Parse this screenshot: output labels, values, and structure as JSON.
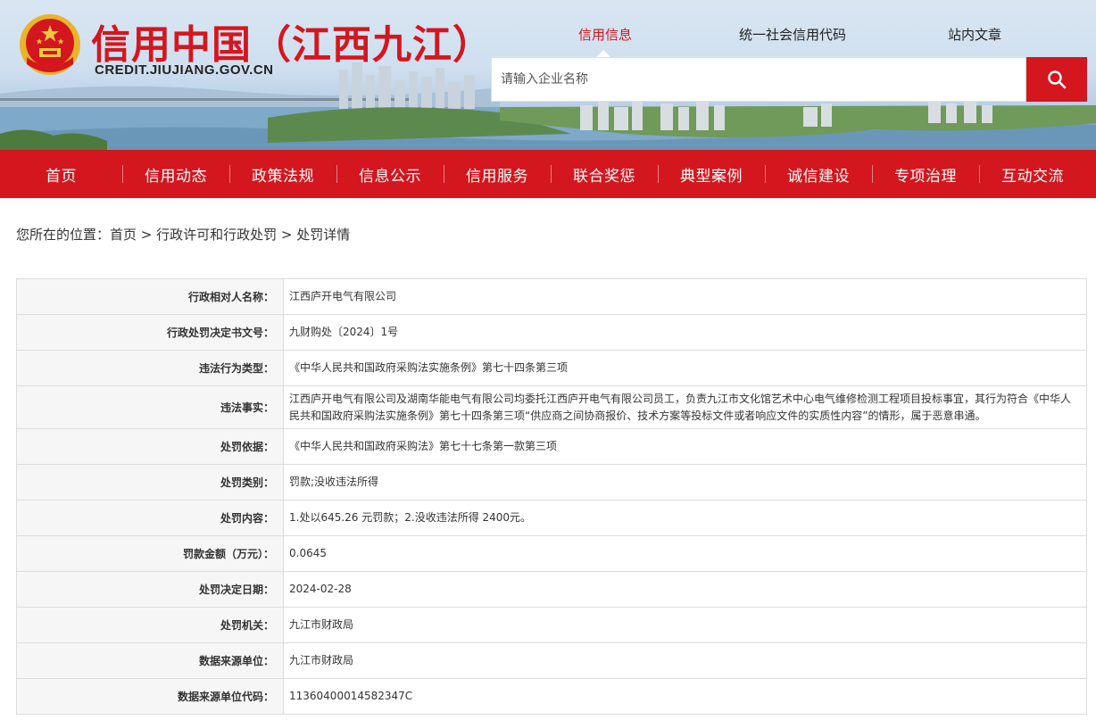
{
  "header": {
    "site_title": "信用中国（江西九江）",
    "site_url": "CREDIT.JIUJIANG.GOV.CN",
    "search_tabs": [
      "信用信息",
      "统一社会信用代码",
      "站内文章"
    ],
    "search_placeholder": "请输入企业名称"
  },
  "nav": {
    "items": [
      "首页",
      "信用动态",
      "政策法规",
      "信息公示",
      "信用服务",
      "联合奖惩",
      "典型案例",
      "诚信建设",
      "专项治理",
      "互动交流"
    ]
  },
  "breadcrumb": {
    "prefix": "您所在的位置：",
    "items": [
      "首页",
      "行政许可和行政处罚",
      "处罚详情"
    ],
    "separator": " > "
  },
  "detail": {
    "rows": [
      {
        "label": "行政相对人名称：",
        "value": "江西庐开电气有限公司"
      },
      {
        "label": "行政处罚决定书文号：",
        "value": "九财购处〔2024〕1号"
      },
      {
        "label": "违法行为类型：",
        "value": "《中华人民共和国政府采购法实施条例》第七十四条第三项"
      },
      {
        "label": "违法事实：",
        "value": "江西庐开电气有限公司及湖南华能电气有限公司均委托江西庐开电气有限公司员工，负责九江市文化馆艺术中心电气维修检测工程项目投标事宜，其行为符合《中华人民共和国政府采购法实施条例》第七十四条第三项“供应商之间协商报价、技术方案等投标文件或者响应文件的实质性内容”的情形，属于恶意串通。"
      },
      {
        "label": "处罚依据：",
        "value": "《中华人民共和国政府采购法》第七十七条第一款第三项"
      },
      {
        "label": "处罚类别：",
        "value": "罚款;没收违法所得"
      },
      {
        "label": "处罚内容：",
        "value": "1.处以645.26 元罚款；2.没收违法所得 2400元。"
      },
      {
        "label": "罚款金额（万元）：",
        "value": "0.0645"
      },
      {
        "label": "处罚决定日期：",
        "value": "2024-02-28"
      },
      {
        "label": "处罚机关：",
        "value": "九江市财政局"
      },
      {
        "label": "数据来源单位：",
        "value": "九江市财政局"
      },
      {
        "label": "数据来源单位代码：",
        "value": "11360400014582347C"
      }
    ]
  },
  "colors": {
    "brand_red": "#d4161e",
    "label_bg": "#f6f6f6",
    "border": "#dcdcdc"
  },
  "icons": {
    "search": "search-icon",
    "emblem": "national-emblem-icon"
  }
}
